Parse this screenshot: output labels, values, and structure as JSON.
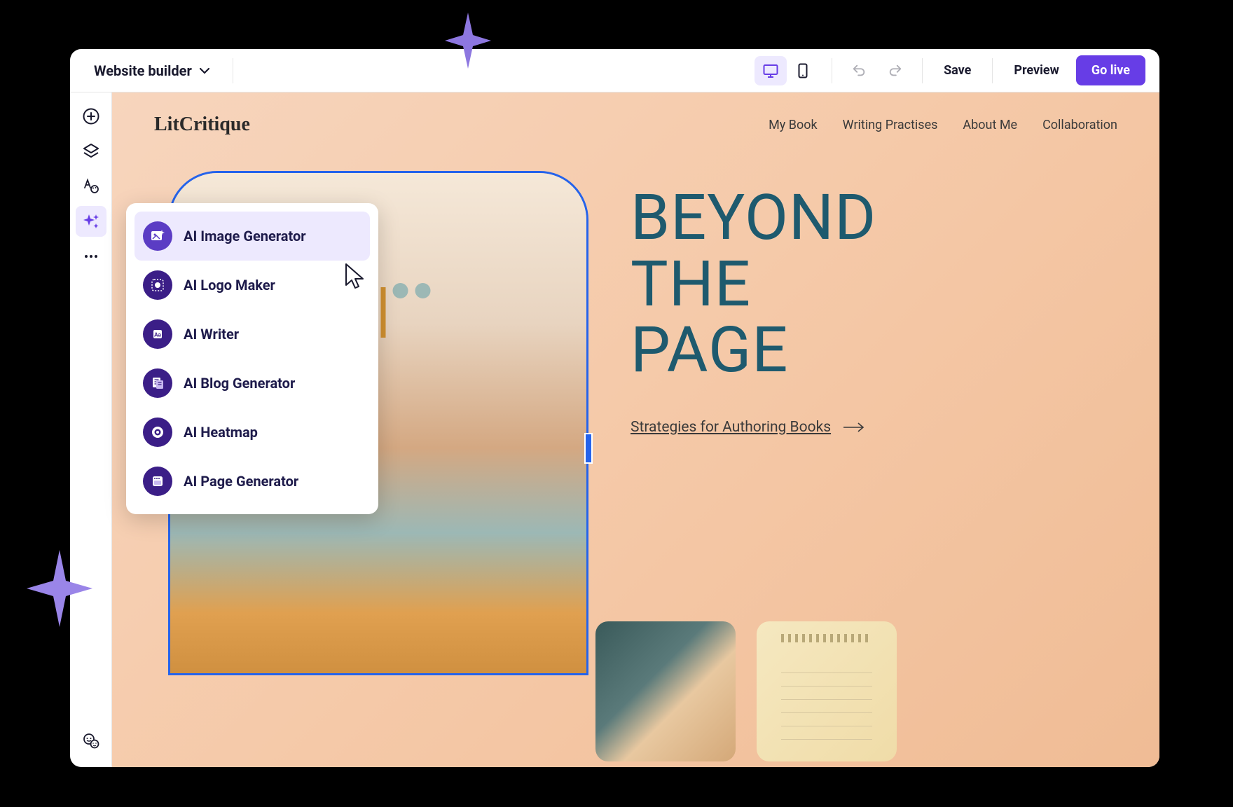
{
  "topbar": {
    "brand": "Website builder",
    "save": "Save",
    "preview": "Preview",
    "golive": "Go live"
  },
  "site": {
    "brand": "LitCritique",
    "nav": [
      "My Book",
      "Writing Practises",
      "About Me",
      "Collaboration"
    ],
    "hero": {
      "line1": "BEYOND",
      "line2": "THE",
      "line3": "PAGE",
      "link": "Strategies for Authoring Books"
    }
  },
  "ai_menu": [
    {
      "label": "AI Image Generator",
      "icon": "image-sparkle",
      "selected": true
    },
    {
      "label": "AI Logo Maker",
      "icon": "logo",
      "selected": false
    },
    {
      "label": "AI Writer",
      "icon": "writer",
      "selected": false
    },
    {
      "label": "AI Blog Generator",
      "icon": "blog",
      "selected": false
    },
    {
      "label": "AI Heatmap",
      "icon": "heatmap",
      "selected": false
    },
    {
      "label": "AI Page Generator",
      "icon": "page",
      "selected": false
    }
  ],
  "colors": {
    "accent": "#673de6",
    "hero_text": "#1e5a6e"
  }
}
